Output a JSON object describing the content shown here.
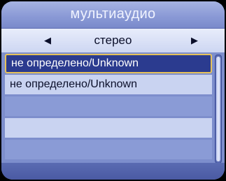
{
  "dialog": {
    "title": "мультиаудио",
    "selector": {
      "value": "стерео",
      "left_icon": "triangle-left-icon",
      "right_icon": "triangle-right-icon"
    },
    "tracks": [
      {
        "label": "не определено/Unknown",
        "selected": true
      },
      {
        "label": "не определено/Unknown",
        "selected": false
      }
    ]
  },
  "colors": {
    "panel": "#7d8ecc",
    "selected_bg": "#2b3b8f",
    "selected_border": "#e6c25a"
  }
}
